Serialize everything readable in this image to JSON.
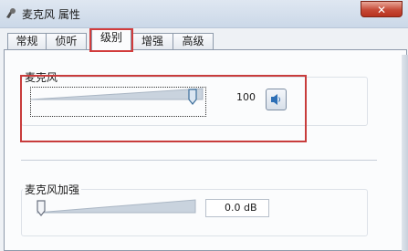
{
  "window": {
    "title": "麦克风 属性",
    "close_label": "✕"
  },
  "tabs": [
    {
      "label": "常规",
      "active": false
    },
    {
      "label": "侦听",
      "active": false
    },
    {
      "label": "级别",
      "active": true
    },
    {
      "label": "增强",
      "active": false
    },
    {
      "label": "高级",
      "active": false
    }
  ],
  "microphone": {
    "label": "麦克风",
    "level": 100,
    "level_text": "100",
    "muted": false
  },
  "boost": {
    "label": "麦克风加强",
    "level_fraction": 0,
    "value_text": "0.0 dB"
  },
  "colors": {
    "highlight_frame": "#c83c3c",
    "thumb_fill": "#dbe6f2"
  }
}
